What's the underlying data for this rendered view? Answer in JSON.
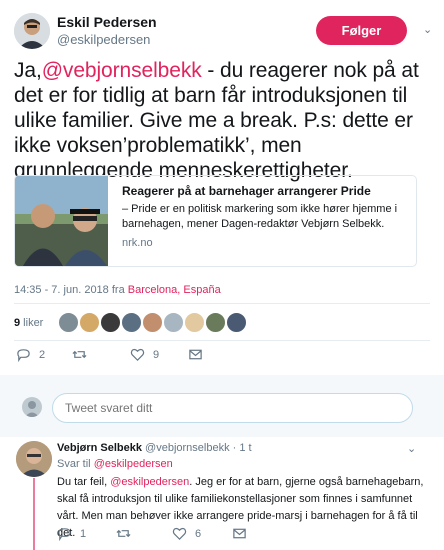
{
  "author": {
    "name": "Eskil Pedersen",
    "handle": "@eskilpedersen",
    "follow_label": "Følger"
  },
  "tweet": {
    "prefix": "Ja,",
    "mention": "@vebjornselbekk",
    "body": " - du reagerer nok på at det er for tidlig at barn får introduksjonen til ulike familier. Give me a break. P.s: dette er ikke voksen’problematikk’, men grunnleggende menneskerettigheter."
  },
  "card": {
    "title": "Reagerer på at barnehager arrangerer Pride",
    "description": "– Pride er en politisk markering som ikke hører hjemme i barnehagen, mener Dagen-redaktør Vebjørn Selbekk.",
    "domain": "nrk.no"
  },
  "meta": {
    "time": "14:35 - 7. jun. 2018 fra ",
    "location": "Barcelona, España"
  },
  "likes": {
    "count": "9",
    "label": " liker"
  },
  "actions": {
    "replies": "2",
    "retweets": "",
    "likes": "9"
  },
  "composer": {
    "placeholder": "Tweet svaret ditt"
  },
  "reply": {
    "name": "Vebjørn Selbekk",
    "handle": "@vebjornselbekk",
    "time": "· 1 t",
    "replying_prefix": "Svar til ",
    "replying_to": "@eskilpedersen",
    "text_prefix": "Du tar feil, ",
    "text_mention": "@eskilpedersen",
    "text_body": ". Jeg er for at barn, gjerne også barnehagebarn, skal få introduksjon til ulike familiekonstellasjoner som finnes i samfunnet vårt. Men man behøver ikke arrangere pride-marsj i barnehagen for å få til det.",
    "actions": {
      "replies": "1",
      "retweets": "",
      "likes": "6"
    }
  },
  "colors": {
    "accent": "#e0245e",
    "muted": "#657786",
    "border": "#e6ecf0"
  }
}
